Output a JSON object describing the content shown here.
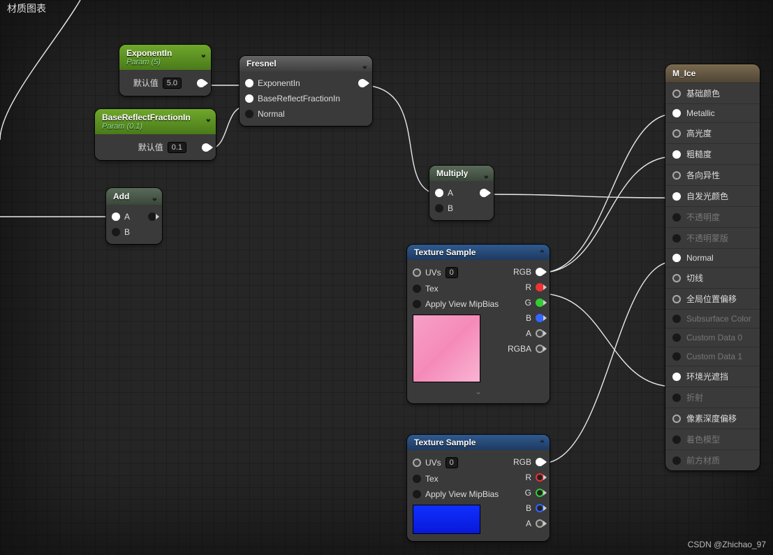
{
  "page": {
    "title": "材质图表",
    "watermark": "CSDN @Zhichao_97"
  },
  "nodes": {
    "expIn": {
      "title": "ExponentIn",
      "sub": "Param (5)",
      "defaultLabel": "默认值",
      "default": "5.0"
    },
    "baseRef": {
      "title": "BaseReflectFractionIn",
      "sub": "Param (0.1)",
      "defaultLabel": "默认值",
      "default": "0.1"
    },
    "add": {
      "title": "Add",
      "a": "A",
      "b": "B"
    },
    "fresnel": {
      "title": "Fresnel",
      "p0": "ExponentIn",
      "p1": "BaseReflectFractionIn",
      "p2": "Normal"
    },
    "mult": {
      "title": "Multiply",
      "a": "A",
      "b": "B"
    },
    "tex1": {
      "title": "Texture Sample",
      "uvs": "UVs",
      "uvval": "0",
      "tex": "Tex",
      "mip": "Apply View MipBias",
      "rgb": "RGB",
      "r": "R",
      "g": "G",
      "b": "B",
      "a": "A",
      "rgba": "RGBA"
    },
    "tex2": {
      "title": "Texture Sample",
      "uvs": "UVs",
      "uvval": "0",
      "tex": "Tex",
      "mip": "Apply View MipBias",
      "rgb": "RGB",
      "r": "R",
      "g": "G",
      "b": "B",
      "a": "A"
    }
  },
  "material": {
    "title": "M_Ice",
    "pins": [
      {
        "label": "基础颜色",
        "active": true,
        "ring": true
      },
      {
        "label": "Metallic",
        "active": true,
        "filled": true
      },
      {
        "label": "高光度",
        "active": true,
        "ring": true
      },
      {
        "label": "粗糙度",
        "active": true,
        "filled": true
      },
      {
        "label": "各向异性",
        "active": true,
        "ring": true
      },
      {
        "label": "自发光颜色",
        "active": true,
        "filled": true
      },
      {
        "label": "不透明度",
        "active": false
      },
      {
        "label": "不透明蒙版",
        "active": false
      },
      {
        "label": "Normal",
        "active": true,
        "filled": true
      },
      {
        "label": "切线",
        "active": true,
        "ring": true
      },
      {
        "label": "全局位置偏移",
        "active": true,
        "ring": true
      },
      {
        "label": "Subsurface Color",
        "active": false
      },
      {
        "label": "Custom Data 0",
        "active": false
      },
      {
        "label": "Custom Data 1",
        "active": false
      },
      {
        "label": "环境光遮挡",
        "active": true,
        "filled": true
      },
      {
        "label": "折射",
        "active": false
      },
      {
        "label": "像素深度偏移",
        "active": true,
        "ring": true
      },
      {
        "label": "着色模型",
        "active": false
      },
      {
        "label": "前方材质",
        "active": false
      }
    ]
  }
}
